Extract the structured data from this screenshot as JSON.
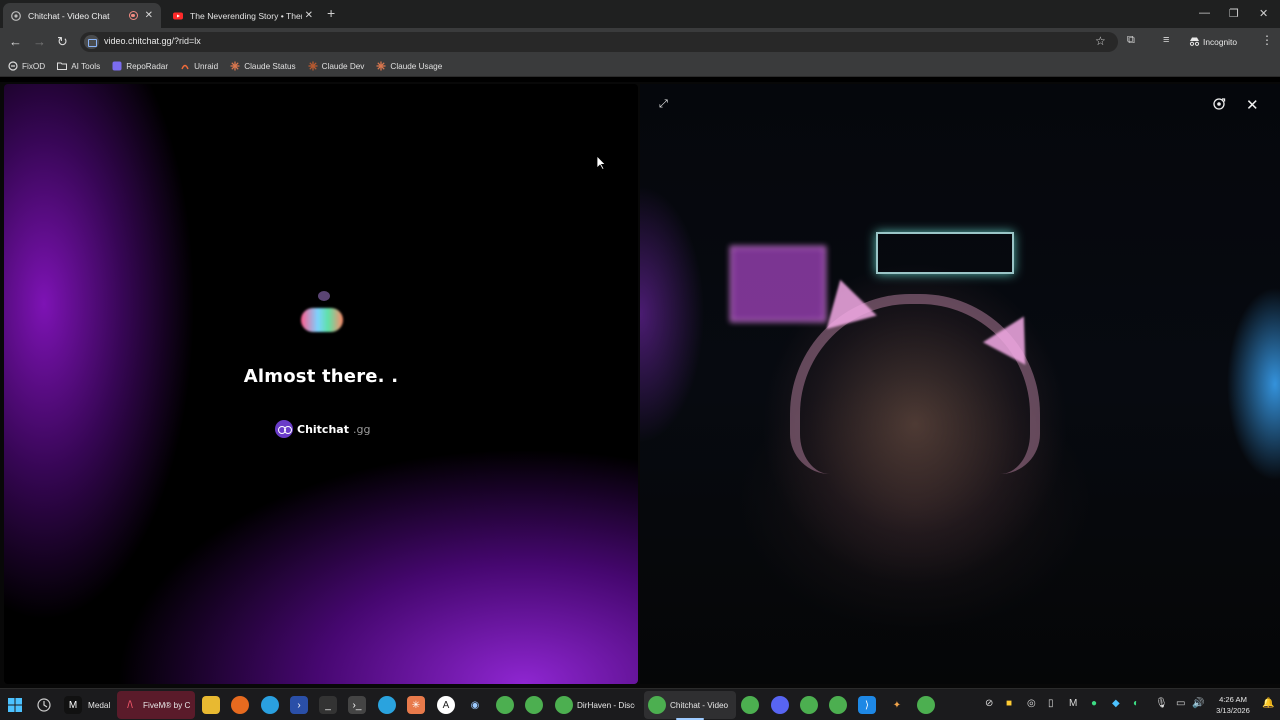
{
  "browser": {
    "tabs": [
      {
        "title": "Chitchat - Video Chat",
        "active": true,
        "recording": true
      },
      {
        "title": "The Neverending Story • Theme",
        "active": false
      }
    ],
    "new_tab_icon": "+",
    "window_controls": {
      "minimize": "—",
      "maximize": "❐",
      "close": "✕"
    },
    "address": "video.chitchat.gg/?rid=lx",
    "profile_label": "Incognito",
    "bookmarks": [
      "FixOD",
      "AI Tools",
      "RepoRadar",
      "Unraid",
      "Claude Status",
      "Claude Dev",
      "Claude Usage"
    ]
  },
  "page": {
    "status_text": "Almost there. .",
    "brand_name": "Chitchat",
    "brand_suffix": ".gg"
  },
  "taskbar": {
    "apps": [
      "Medal",
      "FiveM® by C",
      "DirHaven - Disco",
      "Chitchat - Video"
    ],
    "time": "4:26 AM",
    "date": "3/13/2026"
  },
  "colors": {
    "accent_purple": "#8a1fd0",
    "tab_active_bg": "#3a3b3c",
    "taskbar_bg": "#1b1b1d",
    "taskbar_active_underline": "#9ecbff"
  }
}
